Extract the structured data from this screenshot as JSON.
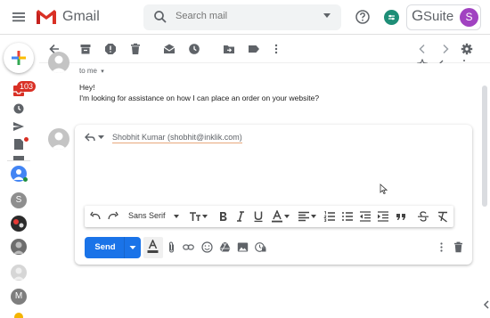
{
  "header": {
    "app_name": "Gmail",
    "search_placeholder": "Search mail",
    "gsuite_label": "Suite",
    "gsuite_g": "G",
    "account_initial": "S"
  },
  "left_rail": {
    "inbox_badge": "103",
    "avatars": [
      {
        "initial": "S",
        "color": "#8e8e8e"
      },
      {
        "initial": "M",
        "color": "#7e7e7e"
      }
    ]
  },
  "message": {
    "to_label": "to me",
    "greeting": "Hey!",
    "body": "I'm looking for assistance on how I can place an order on your website?"
  },
  "reply": {
    "recipient": "Shobhit Kumar (shobhit@inklik.com)",
    "font_name": "Sans Serif",
    "send_label": "Send"
  },
  "colors": {
    "accent": "#1a73e8",
    "brand_red": "#d93025",
    "avatar_purple": "#a142c1",
    "settings_green": "#1e8e77"
  }
}
